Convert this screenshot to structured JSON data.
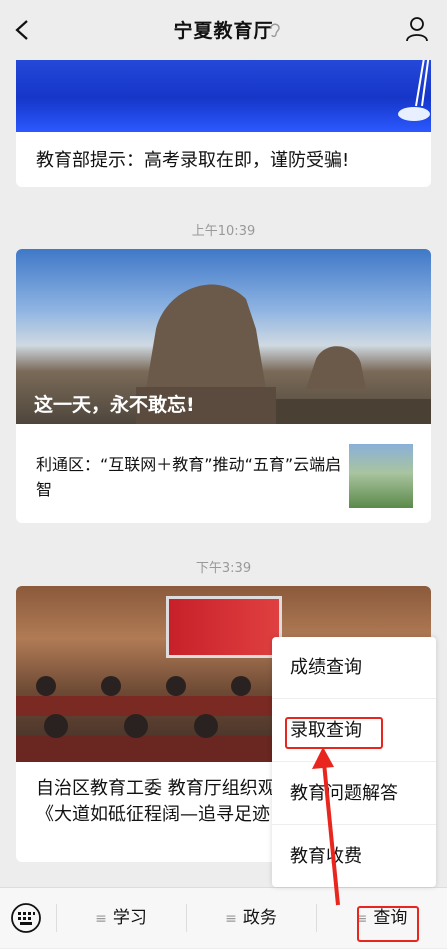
{
  "header": {
    "title": "宁夏教育厅"
  },
  "articles": {
    "first_title": "教育部提示：高考录取在即，谨防受骗!",
    "time1": "上午10:39",
    "featured_caption": "这一天，永不敢忘!",
    "sub_article": "利通区：“互联网＋教育”推动“五育”云端启智",
    "time2": "下午3:39",
    "third_title": "自治区教育工委 教育厅组织观看教育专题片《大道如砥征程阔—追寻足迹 感悟思想伟力》"
  },
  "bottom_menu": {
    "tabs": [
      {
        "label": "学习"
      },
      {
        "label": "政务"
      },
      {
        "label": "查询"
      }
    ]
  },
  "popup_menu": {
    "items": [
      {
        "label": "成绩查询"
      },
      {
        "label": "录取查询"
      },
      {
        "label": "教育问题解答"
      },
      {
        "label": "教育收费"
      }
    ]
  },
  "colors": {
    "highlight": "#e8261d",
    "background": "#ededed"
  }
}
